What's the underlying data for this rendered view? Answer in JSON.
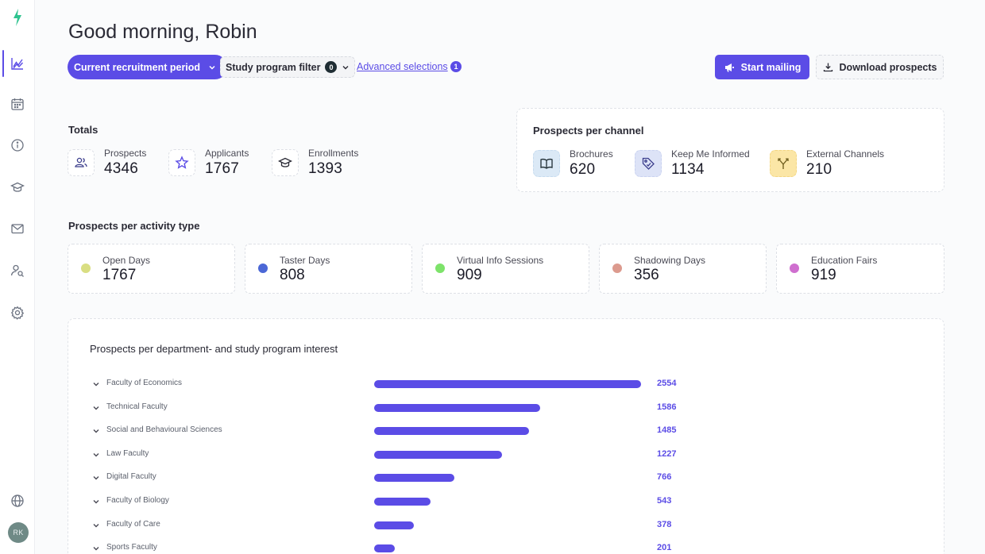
{
  "user": {
    "initials": "RK"
  },
  "header": {
    "greeting": "Good morning, Robin",
    "period_label": "Current recruitment period",
    "study_filter_label": "Study program filter",
    "study_filter_count": "0",
    "advanced_label": "Advanced selections",
    "advanced_count": "1",
    "start_mailing_label": "Start mailing",
    "download_label": "Download prospects"
  },
  "totals": {
    "title": "Totals",
    "items": [
      {
        "label": "Prospects",
        "value": "4346",
        "icon": "users-icon"
      },
      {
        "label": "Applicants",
        "value": "1767",
        "icon": "star-icon"
      },
      {
        "label": "Enrollments",
        "value": "1393",
        "icon": "graduation-cap-icon"
      }
    ]
  },
  "channels": {
    "title": "Prospects per channel",
    "items": [
      {
        "label": "Brochures",
        "value": "620",
        "icon": "book-icon"
      },
      {
        "label": "Keep Me Informed",
        "value": "1134",
        "icon": "tag-icon"
      },
      {
        "label": "External Channels",
        "value": "210",
        "icon": "split-arrows-icon"
      }
    ]
  },
  "activities": {
    "title": "Prospects per activity type",
    "items": [
      {
        "label": "Open Days",
        "value": "1767",
        "color": "#d9de82"
      },
      {
        "label": "Taster Days",
        "value": "808",
        "color": "#4b67d6"
      },
      {
        "label": "Virtual Info Sessions",
        "value": "909",
        "color": "#7de36a"
      },
      {
        "label": "Shadowing Days",
        "value": "356",
        "color": "#dc9a8e"
      },
      {
        "label": "Education Fairs",
        "value": "919",
        "color": "#cf6fcf"
      }
    ]
  },
  "departments": {
    "title": "Prospects per department- and study program interest",
    "max": 2554,
    "items": [
      {
        "name": "Faculty of Economics",
        "value": "2554",
        "count": 2554
      },
      {
        "name": "Technical Faculty",
        "value": "1586",
        "count": 1586
      },
      {
        "name": "Social and Behavioural Sciences",
        "value": "1485",
        "count": 1485
      },
      {
        "name": "Law Faculty",
        "value": "1227",
        "count": 1227
      },
      {
        "name": "Digital Faculty",
        "value": "766",
        "count": 766
      },
      {
        "name": "Faculty of Biology",
        "value": "543",
        "count": 543
      },
      {
        "name": "Faculty of Care",
        "value": "378",
        "count": 378
      },
      {
        "name": "Sports Faculty",
        "value": "201",
        "count": 201
      }
    ]
  },
  "colors": {
    "accent": "#5b4ce6",
    "dark_badge": "#1f2d33"
  }
}
